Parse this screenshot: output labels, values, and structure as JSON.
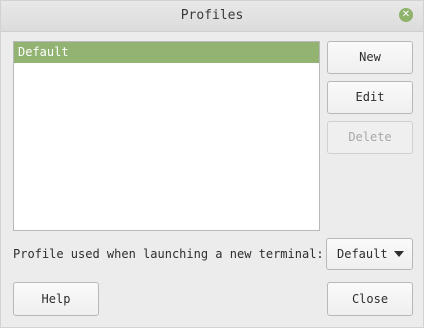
{
  "window": {
    "title": "Profiles",
    "close_icon": "close-circle-icon",
    "accent_color": "#92b372"
  },
  "profiles": {
    "items": [
      {
        "label": "Default",
        "selected": true
      }
    ]
  },
  "actions": {
    "new_label": "New",
    "edit_label": "Edit",
    "delete_label": "Delete",
    "delete_disabled": true
  },
  "launch": {
    "label": "Profile used when launching a new terminal:",
    "selected_value": "Default",
    "dropdown_icon": "triangle-down-icon"
  },
  "footer": {
    "help_label": "Help",
    "close_label": "Close"
  }
}
